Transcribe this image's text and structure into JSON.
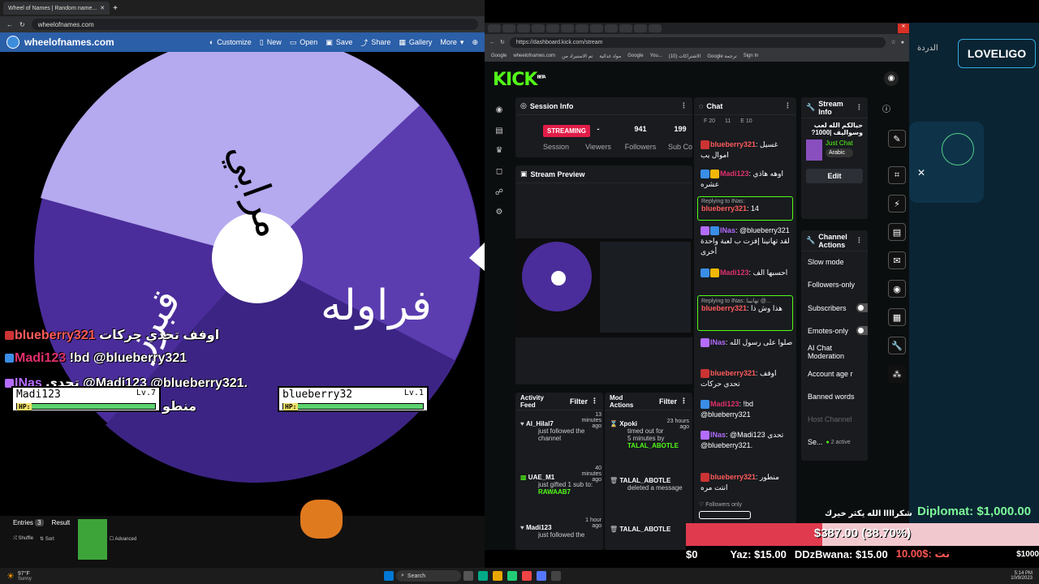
{
  "left_browser": {
    "tab_title": "Wheel of Names | Random name...",
    "url": "wheelofnames.com",
    "site_name": "wheelofnames.com",
    "menu": [
      "Customize",
      "New",
      "Open",
      "Save",
      "Share",
      "Gallery",
      "More"
    ],
    "wheel_labels": [
      "مرابي",
      "فراوله",
      "قبرز"
    ],
    "bottom_tabs": [
      "Entries",
      "Result"
    ],
    "entries_count": "3",
    "buttons": [
      "Shuffle",
      "Sort",
      "Advanced"
    ]
  },
  "overlay_chat": [
    {
      "user": "blueberry321",
      "msg": "اوفف تحدي حركات"
    },
    {
      "user": "Madi123",
      "msg": "!bd @blueberry321"
    },
    {
      "user": "INas",
      "msg": "تحدى @Madi123 @blueberry321."
    },
    {
      "user": "",
      "msg": "منطو"
    }
  ],
  "hp_cards": [
    {
      "name": "Madi123",
      "level": "Lv.7",
      "hp": "HP:"
    },
    {
      "name": "blueberry32",
      "level": "Lv.1",
      "hp": "HP:"
    }
  ],
  "right_browser": {
    "url": "https://dashboard.kick.com/stream",
    "bookmarks": [
      "Google",
      "wheelofnames.com",
      "تم الاستيراد من",
      "مواد غذائية",
      "Google",
      "You...",
      "الاشتراكات (10)",
      "Google ترجمة",
      "Sign In"
    ],
    "logo": "KICK",
    "logo_sup": "BETA"
  },
  "session": {
    "title": "Session Info",
    "status": "STREAMING",
    "status_label": "Session",
    "stats": [
      {
        "value": "-",
        "label": "Viewers"
      },
      {
        "value": "941",
        "label": "Followers"
      },
      {
        "value": "199",
        "label": "Sub Count"
      }
    ]
  },
  "preview": {
    "title": "Stream Preview"
  },
  "activity": {
    "title": "Activity Feed",
    "filter": "Filter",
    "items": [
      {
        "name": "Al_Hilal7",
        "text": "just followed the channel",
        "time": "13 minutes ago"
      },
      {
        "name": "UAE_M1",
        "text": "just gifted 1 sub to:",
        "target": "RAWAAB7",
        "time": "40 minutes ago"
      },
      {
        "name": "Madi123",
        "text": "just followed the",
        "time": "1 hour ago"
      }
    ]
  },
  "mod": {
    "title": "Mod Actions",
    "filter": "Filter",
    "items": [
      {
        "name": "Xpoki",
        "text": "timed out for 5 minutes by",
        "target": "TALAL_ABOTLE",
        "time": "23 hours ago"
      },
      {
        "name": "TALAL_ABOTLE",
        "text": "deleted a message"
      },
      {
        "name": "TALAL_ABOTLE",
        "text": ""
      }
    ]
  },
  "chat": {
    "title": "Chat",
    "counters": [
      "F 20",
      "11",
      "E 10"
    ],
    "footer": "Followers only",
    "messages": [
      {
        "user": "blueberry321",
        "text": "غسيل اموال يب",
        "color": "red"
      },
      {
        "user": "Madi123",
        "text": "اوهه هاذي عشره",
        "color": "pink"
      },
      {
        "reply": "Replying to INas:",
        "user": "blueberry321",
        "text": "14",
        "color": "red"
      },
      {
        "user": "INas",
        "text": "@blueberry321 لقد تهانينا إفزت ب لعبة واحدة أخرى",
        "color": "purple"
      },
      {
        "user": "Madi123",
        "text": "احسبها الف",
        "color": "pink"
      },
      {
        "reply": "Replying to INas: تهانينا @...",
        "user": "blueberry321",
        "text": "هذا وش ذا",
        "color": "red"
      },
      {
        "user": "INas",
        "text": "صلوا على رسول الله",
        "color": "purple"
      },
      {
        "user": "blueberry321",
        "text": "اوفف تحدي حركات",
        "color": "red"
      },
      {
        "user": "Madi123",
        "text": "!bd @blueberry321",
        "color": "pink"
      },
      {
        "user": "INas",
        "text": "@Madi123 تحدى @blueberry321.",
        "color": "purple"
      },
      {
        "user": "blueberry321",
        "text": "منطور انتت مره",
        "color": "red"
      }
    ]
  },
  "stream_info": {
    "title": "Stream Info",
    "stream_title": "حيالكم الله لعب وسواليف |1000?",
    "category": "Just Chat",
    "language": "Arabic",
    "edit": "Edit"
  },
  "channel_actions": {
    "title": "Channel Actions",
    "items": [
      "Slow mode",
      "Followers-only",
      "Subscribers",
      "Emotes-only",
      "AI Chat Moderation",
      "Account age r",
      "Banned words",
      "Host Channel",
      "Se..."
    ],
    "security_active": "2 active"
  },
  "far_right": {
    "arabic_top": "الدردة",
    "brand": "LOVELIGO",
    "thanks": "شكراااا الله يكثر خيرك",
    "diplomat": "Diplomat: $1,000.00",
    "goal": "$387.00 (38.70%)",
    "goal_fraction": 0.387,
    "min": "$0",
    "max": "$1000",
    "donors": [
      "Yaz: $15.00",
      "DDzBwana: $15.00",
      "10.00$: نت"
    ]
  },
  "taskbar": {
    "weather": "97°F",
    "weather_sub": "Sunny",
    "search": "Search",
    "time": "5:14 PM",
    "date": "10/9/2023"
  }
}
